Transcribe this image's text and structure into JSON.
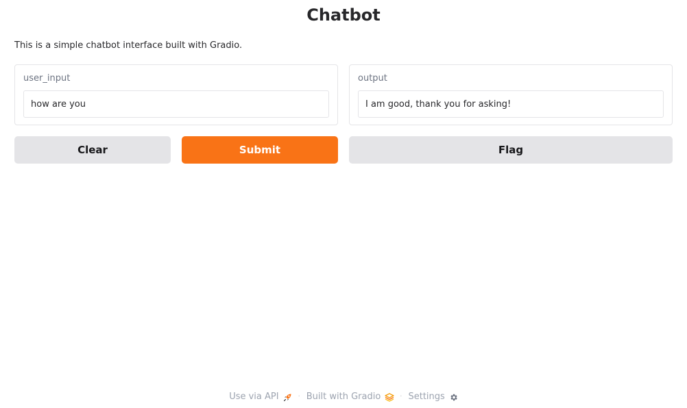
{
  "app": {
    "title": "Chatbot",
    "description": "This is a simple chatbot interface built with Gradio."
  },
  "inputs": {
    "user_input": {
      "label": "user_input",
      "value": "how are you"
    }
  },
  "outputs": {
    "output": {
      "label": "output",
      "value": "I am good, thank you for asking!"
    }
  },
  "buttons": {
    "clear_label": "Clear",
    "submit_label": "Submit",
    "flag_label": "Flag"
  },
  "footer": {
    "api_label": "Use via API",
    "api_icon": "rocket-icon",
    "built_label": "Built with Gradio",
    "built_icon": "gradio-logo-icon",
    "settings_label": "Settings",
    "settings_icon": "gear-icon",
    "separator": "·"
  },
  "colors": {
    "primary": "#f97316",
    "secondary": "#e4e4e7",
    "border": "#e4e4e7",
    "muted_text": "#9ca3af"
  }
}
